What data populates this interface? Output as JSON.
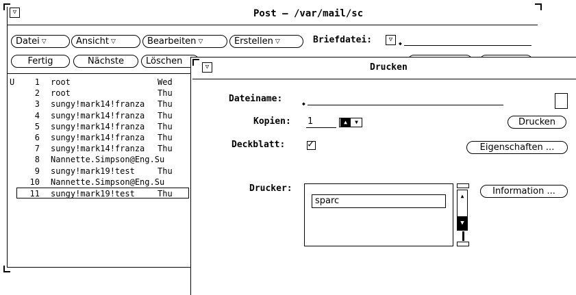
{
  "main_window": {
    "title": "Post – /var/mail/sc",
    "menu_buttons": [
      {
        "label": "Datei"
      },
      {
        "label": "Ansicht"
      },
      {
        "label": "Bearbeiten"
      },
      {
        "label": "Erstellen"
      }
    ],
    "mailfile_label": "Briefdatei:",
    "mailfile_value": "",
    "action_buttons": [
      {
        "label": "Fertig"
      },
      {
        "label": "Nächste"
      },
      {
        "label": "Löschen"
      }
    ],
    "messages": [
      {
        "status": "U",
        "num": "1",
        "sender": "root",
        "date": "Wed"
      },
      {
        "status": "",
        "num": "2",
        "sender": "root",
        "date": "Thu"
      },
      {
        "status": "",
        "num": "3",
        "sender": "sungy!mark14!franza",
        "date": "Thu"
      },
      {
        "status": "",
        "num": "4",
        "sender": "sungy!mark14!franza",
        "date": "Thu"
      },
      {
        "status": "",
        "num": "5",
        "sender": "sungy!mark14!franza",
        "date": "Thu"
      },
      {
        "status": "",
        "num": "6",
        "sender": "sungy!mark14!franza",
        "date": "Thu"
      },
      {
        "status": "",
        "num": "7",
        "sender": "sungy!mark14!franza",
        "date": "Thu"
      },
      {
        "status": "",
        "num": "8",
        "sender": "Nannette.Simpson@Eng.Su",
        "date": ""
      },
      {
        "status": "",
        "num": "9",
        "sender": "sungy!mark19!test",
        "date": "Thu"
      },
      {
        "status": "",
        "num": "10",
        "sender": "Nannette.Simpson@Eng.Su",
        "date": ""
      },
      {
        "status": "",
        "num": "11",
        "sender": "sungy!mark19!test",
        "date": "Thu"
      }
    ],
    "selected_message": "11"
  },
  "print_dialog": {
    "title": "Drucken",
    "filename_label": "Dateiname:",
    "filename_value": "",
    "copies_label": "Kopien:",
    "copies_value": "1",
    "cover_label": "Deckblatt:",
    "cover_checked": true,
    "print_button": "Drucken",
    "properties_button": "Eigenschaften ...",
    "printer_label": "Drucker:",
    "printers": [
      "sparc"
    ],
    "info_button": "Information ..."
  },
  "icons": {
    "window_menu": "window-menu-icon",
    "menu_triangle": "menu-triangle-icon",
    "checkmark": "checkmark-icon",
    "spin_up": "spin-up-icon",
    "spin_down": "spin-down-icon",
    "scroll_up": "scroll-up-arrow-icon",
    "scroll_down": "scroll-down-arrow-icon",
    "caret": "text-caret-icon"
  }
}
